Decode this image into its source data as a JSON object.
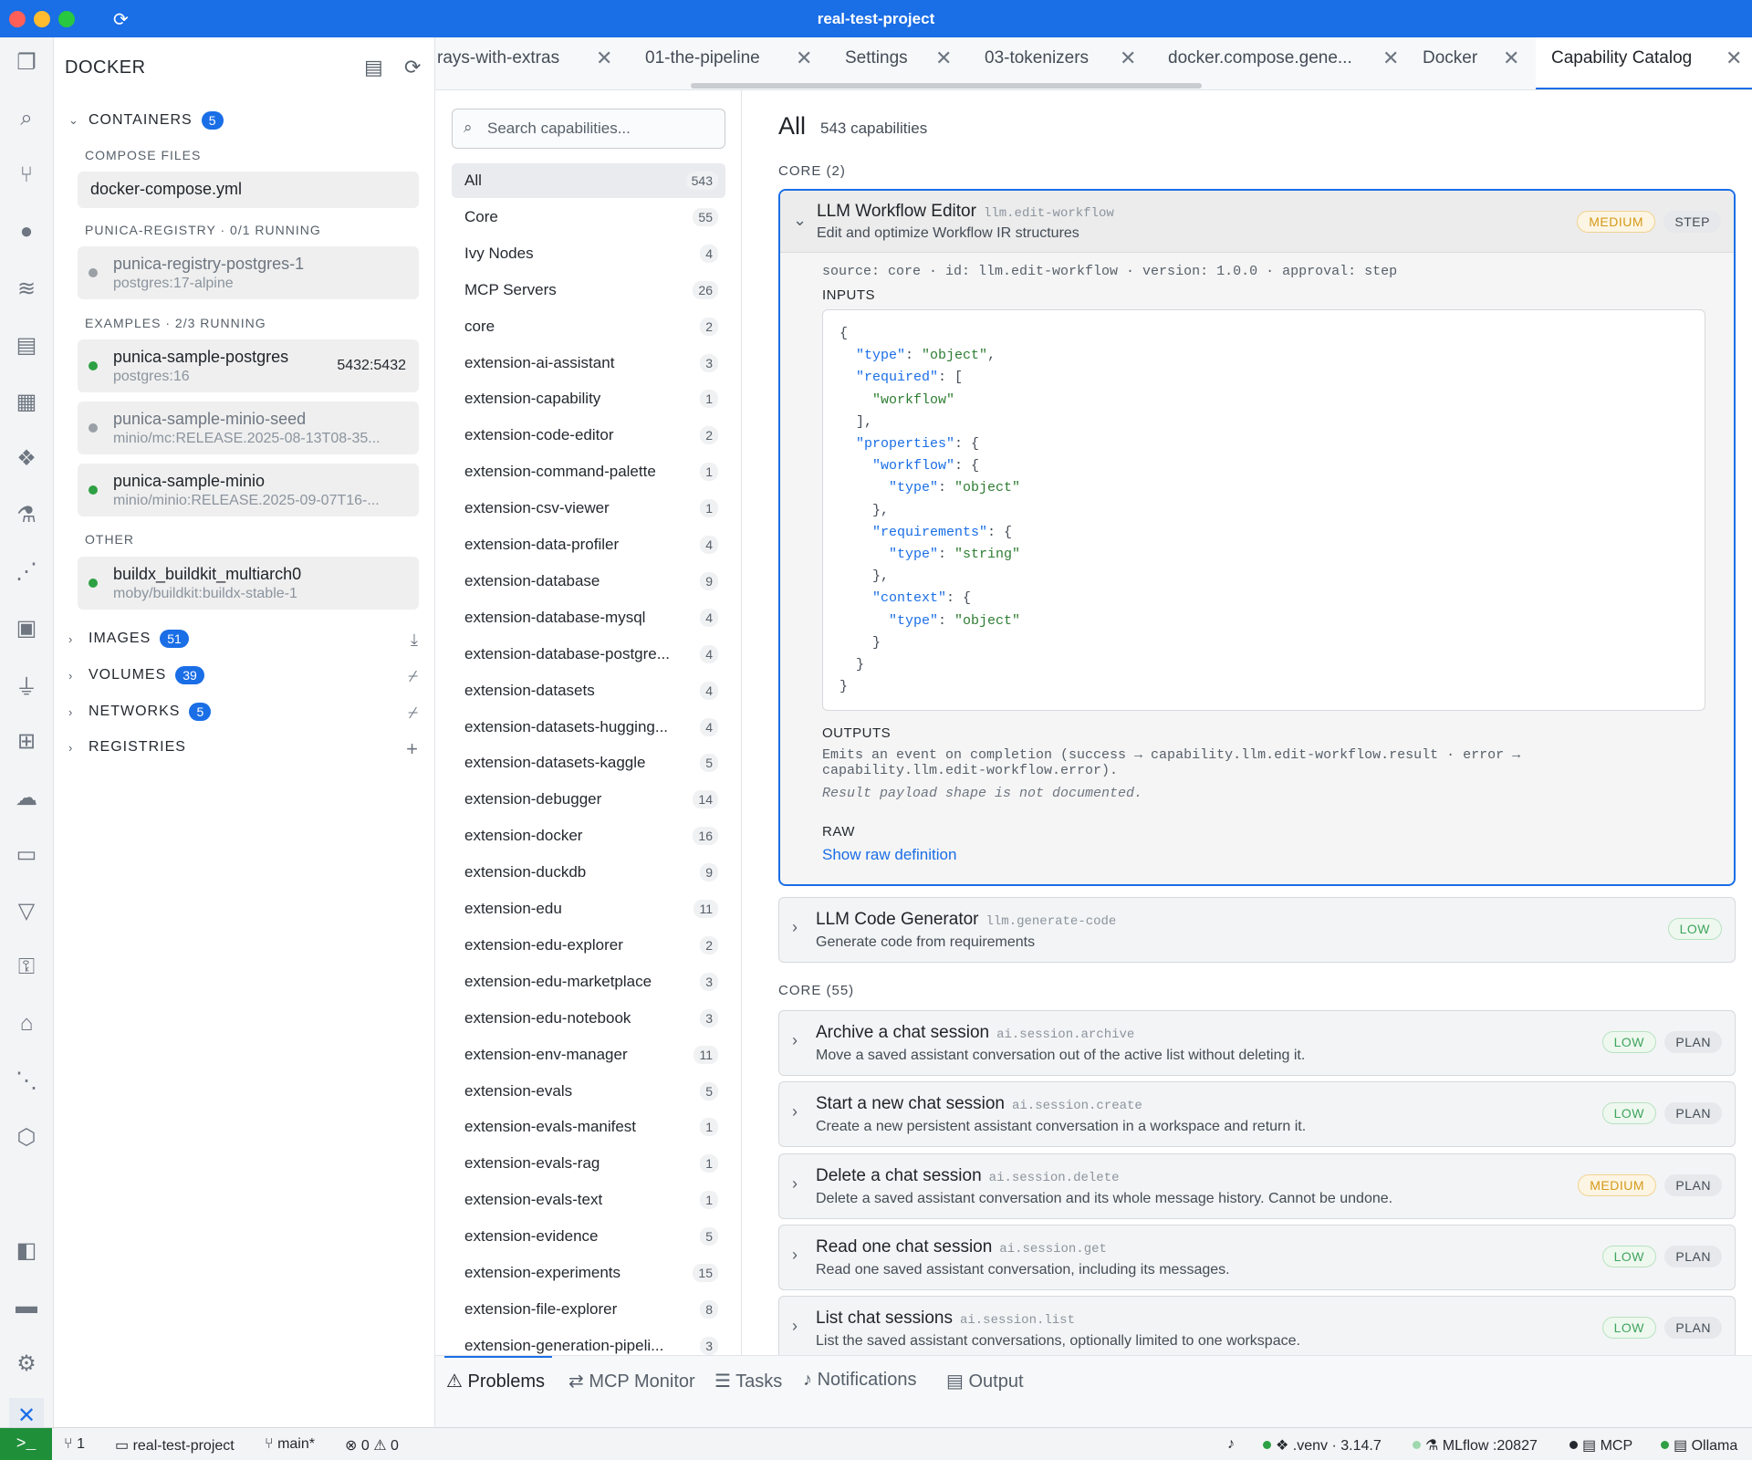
{
  "window": {
    "title": "real-test-project"
  },
  "sidebar": {
    "title": "DOCKER",
    "containers": {
      "label": "CONTAINERS",
      "count": "5",
      "compose_label": "COMPOSE FILES",
      "compose_file": "docker-compose.yml",
      "groups": [
        {
          "label": "PUNICA-REGISTRY · 0/1 RUNNING",
          "items": [
            {
              "name": "punica-registry-postgres-1",
              "image": "postgres:17-alpine",
              "port": "",
              "running": false
            }
          ]
        },
        {
          "label": "EXAMPLES · 2/3 RUNNING",
          "items": [
            {
              "name": "punica-sample-postgres",
              "image": "postgres:16",
              "port": "5432:5432",
              "running": true
            },
            {
              "name": "punica-sample-minio-seed",
              "image": "minio/mc:RELEASE.2025-08-13T08-35...",
              "port": "",
              "running": false
            },
            {
              "name": "punica-sample-minio",
              "image": "minio/minio:RELEASE.2025-09-07T16-...",
              "port": "",
              "running": true
            }
          ]
        },
        {
          "label": "OTHER",
          "items": [
            {
              "name": "buildx_buildkit_multiarch0",
              "image": "moby/buildkit:buildx-stable-1",
              "port": "",
              "running": true
            }
          ]
        }
      ]
    },
    "images": {
      "label": "IMAGES",
      "count": "51"
    },
    "volumes": {
      "label": "VOLUMES",
      "count": "39"
    },
    "networks": {
      "label": "NETWORKS",
      "count": "5"
    },
    "registries": {
      "label": "REGISTRIES"
    }
  },
  "tabs": [
    {
      "label": "rays-with-extras"
    },
    {
      "label": "01-the-pipeline"
    },
    {
      "label": "Settings"
    },
    {
      "label": "03-tokenizers"
    },
    {
      "label": "docker.compose.gene..."
    },
    {
      "label": "Docker"
    },
    {
      "label": "Capability Catalog",
      "active": true
    }
  ],
  "catalog": {
    "search_placeholder": "Search capabilities...",
    "categories": [
      {
        "label": "All",
        "count": "543",
        "active": true
      },
      {
        "label": "Core",
        "count": "55"
      },
      {
        "label": "Ivy Nodes",
        "count": "4"
      },
      {
        "label": "MCP Servers",
        "count": "26"
      },
      {
        "label": "core",
        "count": "2"
      },
      {
        "label": "extension-ai-assistant",
        "count": "3"
      },
      {
        "label": "extension-capability",
        "count": "1"
      },
      {
        "label": "extension-code-editor",
        "count": "2"
      },
      {
        "label": "extension-command-palette",
        "count": "1"
      },
      {
        "label": "extension-csv-viewer",
        "count": "1"
      },
      {
        "label": "extension-data-profiler",
        "count": "4"
      },
      {
        "label": "extension-database",
        "count": "9"
      },
      {
        "label": "extension-database-mysql",
        "count": "4"
      },
      {
        "label": "extension-database-postgre...",
        "count": "4"
      },
      {
        "label": "extension-datasets",
        "count": "4"
      },
      {
        "label": "extension-datasets-hugging...",
        "count": "4"
      },
      {
        "label": "extension-datasets-kaggle",
        "count": "5"
      },
      {
        "label": "extension-debugger",
        "count": "14"
      },
      {
        "label": "extension-docker",
        "count": "16"
      },
      {
        "label": "extension-duckdb",
        "count": "9"
      },
      {
        "label": "extension-edu",
        "count": "11"
      },
      {
        "label": "extension-edu-explorer",
        "count": "2"
      },
      {
        "label": "extension-edu-marketplace",
        "count": "3"
      },
      {
        "label": "extension-edu-notebook",
        "count": "3"
      },
      {
        "label": "extension-env-manager",
        "count": "11"
      },
      {
        "label": "extension-evals",
        "count": "5"
      },
      {
        "label": "extension-evals-manifest",
        "count": "1"
      },
      {
        "label": "extension-evals-rag",
        "count": "1"
      },
      {
        "label": "extension-evals-text",
        "count": "1"
      },
      {
        "label": "extension-evidence",
        "count": "5"
      },
      {
        "label": "extension-experiments",
        "count": "15"
      },
      {
        "label": "extension-file-explorer",
        "count": "8"
      },
      {
        "label": "extension-generation-pipeli...",
        "count": "3"
      }
    ],
    "heading": "All",
    "heading_count": "543 capabilities",
    "section1": "CORE (2)",
    "expanded": {
      "title": "LLM Workflow Editor",
      "id": "llm.edit-workflow",
      "desc": "Edit and optimize Workflow IR structures",
      "risk": "MEDIUM",
      "approval": "STEP",
      "meta": "source: core · id: llm.edit-workflow · version: 1.0.0 · approval: step",
      "inputs_label": "INPUTS",
      "outputs_label": "OUTPUTS",
      "outputs_text": "Emits an event on completion (success → capability.llm.edit-workflow.result · error → capability.llm.edit-workflow.error).",
      "outputs_note": "Result payload shape is not documented.",
      "raw_label": "RAW",
      "raw_link": "Show raw definition"
    },
    "second": {
      "title": "LLM Code Generator",
      "id": "llm.generate-code",
      "desc": "Generate code from requirements",
      "risk": "LOW"
    },
    "section2": "CORE (55)",
    "items": [
      {
        "title": "Archive a chat session",
        "id": "ai.session.archive",
        "desc": "Move a saved assistant conversation out of the active list without deleting it.",
        "risk": "LOW",
        "approval": "PLAN"
      },
      {
        "title": "Start a new chat session",
        "id": "ai.session.create",
        "desc": "Create a new persistent assistant conversation in a workspace and return it.",
        "risk": "LOW",
        "approval": "PLAN"
      },
      {
        "title": "Delete a chat session",
        "id": "ai.session.delete",
        "desc": "Delete a saved assistant conversation and its whole message history. Cannot be undone.",
        "risk": "MEDIUM",
        "approval": "PLAN"
      },
      {
        "title": "Read one chat session",
        "id": "ai.session.get",
        "desc": "Read one saved assistant conversation, including its messages.",
        "risk": "LOW",
        "approval": "PLAN"
      },
      {
        "title": "List chat sessions",
        "id": "ai.session.list",
        "desc": "List the saved assistant conversations, optionally limited to one workspace.",
        "risk": "LOW",
        "approval": "PLAN"
      }
    ]
  },
  "panel_tabs": [
    {
      "label": "Problems",
      "icon": "warning-icon"
    },
    {
      "label": "MCP Monitor",
      "icon": "arrows-icon"
    },
    {
      "label": "Tasks",
      "icon": "checklist-icon"
    },
    {
      "label": "Notifications",
      "icon": "bell-icon"
    },
    {
      "label": "Output",
      "icon": "output-icon"
    }
  ],
  "status": {
    "remotes": "1",
    "project": "real-test-project",
    "branch": "main*",
    "errors": "0",
    "warnings": "0",
    "venv": ".venv · 3.14.7",
    "mlflow": "MLflow :20827",
    "mcp": "MCP",
    "ollama": "Ollama"
  },
  "colors": {
    "accent": "#1a6ee6",
    "running": "#2ea043",
    "stopped": "#9aa0a6",
    "low": "#3fa45e",
    "medium": "#d49a1a"
  }
}
